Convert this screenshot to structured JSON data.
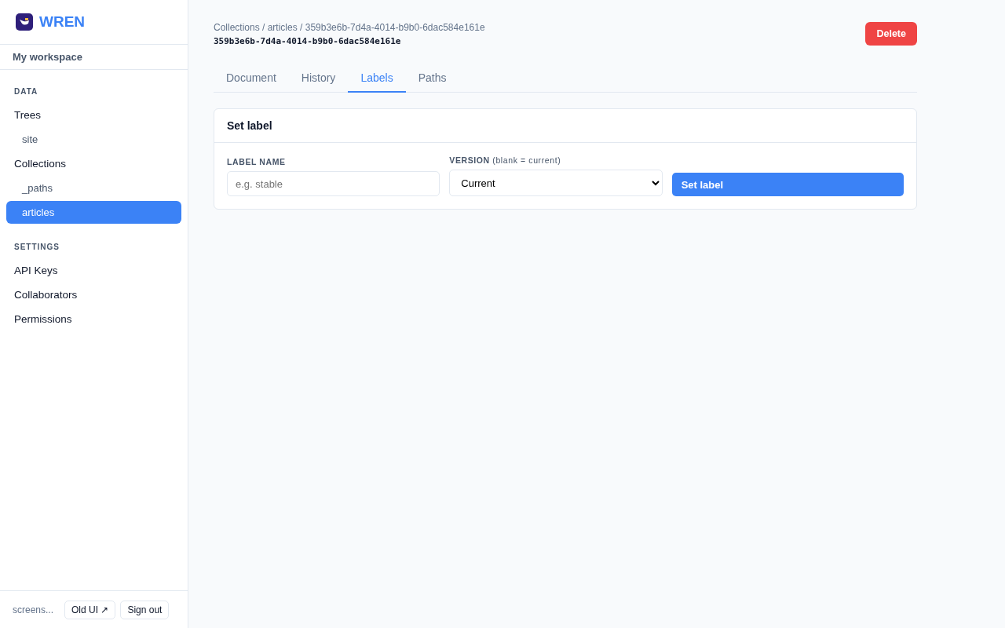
{
  "brand": {
    "name": "WREN"
  },
  "workspace": "My workspace",
  "sidebar": {
    "sections": [
      {
        "heading": "DATA",
        "items": [
          {
            "label": "Trees",
            "selected": false,
            "children": [
              {
                "label": "site",
                "selected": false
              }
            ]
          },
          {
            "label": "Collections",
            "selected": false,
            "children": [
              {
                "label": "_paths",
                "selected": false
              },
              {
                "label": "articles",
                "selected": true
              }
            ]
          }
        ]
      },
      {
        "heading": "SETTINGS",
        "items": [
          {
            "label": "API Keys",
            "selected": false
          },
          {
            "label": "Collaborators",
            "selected": false
          },
          {
            "label": "Permissions",
            "selected": false
          }
        ]
      }
    ]
  },
  "footer": {
    "user": "screens...",
    "buttons": [
      "Old UI ↗",
      "Sign out"
    ]
  },
  "breadcrumb": "Collections / articles / 359b3e6b-7d4a-4014-b9b0-6dac584e161e",
  "doc_id": "359b3e6b-7d4a-4014-b9b0-6dac584e161e",
  "delete_button": "Delete",
  "tabs": [
    {
      "label": "Document",
      "selected": false
    },
    {
      "label": "History",
      "selected": false
    },
    {
      "label": "Labels",
      "selected": true
    },
    {
      "label": "Paths",
      "selected": false
    }
  ],
  "card": {
    "title": "Set label",
    "label_field": {
      "label": "LABEL NAME",
      "placeholder": "e.g. stable"
    },
    "version_field": {
      "label": "**VERSION** (blank = current)",
      "value": "Current"
    },
    "submit": "Set label"
  }
}
